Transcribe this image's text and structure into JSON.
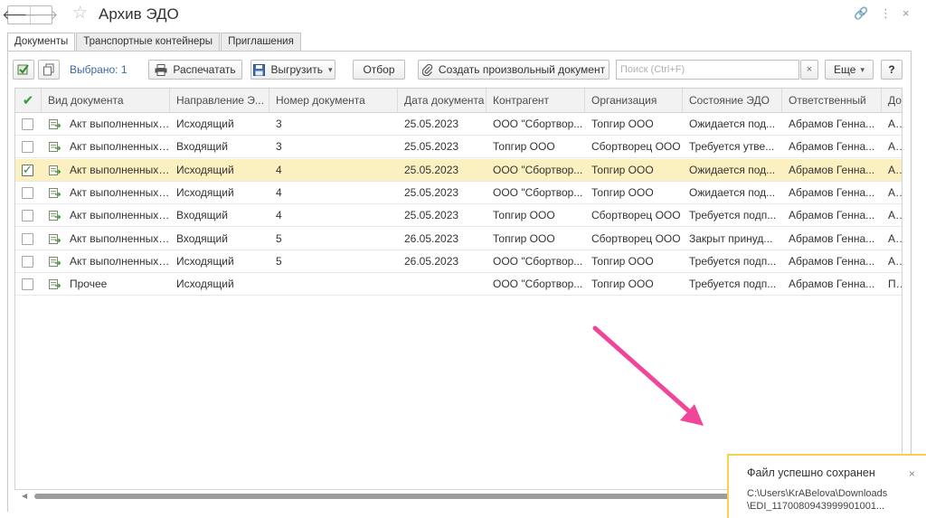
{
  "window": {
    "title": "Архив ЭДО",
    "back_glyph": "🡐",
    "forward_glyph": "🡒",
    "star_glyph": "☆",
    "link_glyph": "🔗",
    "more_glyph": "⋮",
    "close_glyph": "×"
  },
  "tabs": [
    {
      "label": "Документы",
      "active": true
    },
    {
      "label": "Транспортные контейнеры",
      "active": false
    },
    {
      "label": "Приглашения",
      "active": false
    }
  ],
  "toolbar": {
    "selected_label": "Выбрано: 1",
    "print_label": "Распечатать",
    "export_label": "Выгрузить",
    "filter_label": "Отбор",
    "create_label": "Создать произвольный документ",
    "search_placeholder": "Поиск (Ctrl+F)",
    "clear_glyph": "×",
    "more_label": "Еще",
    "help_label": "?",
    "dropdown_glyph": "▾"
  },
  "columns": [
    "Вид документа",
    "Направление Э...",
    "Номер документа",
    "Дата документа",
    "Контрагент",
    "Организация",
    "Состояние ЭДО",
    "Ответственный",
    "Док"
  ],
  "rows": [
    {
      "checked": false,
      "type": "Акт выполненных ...",
      "direction": "Исходящий",
      "number": "3",
      "date": "25.05.2023",
      "counterparty": "ООО \"Сбортвор...",
      "org": "Топгир ООО",
      "state": "Ожидается под...",
      "responsible": "Абрамов Генна...",
      "doc": "Акт"
    },
    {
      "checked": false,
      "type": "Акт выполненных ...",
      "direction": "Входящий",
      "number": "3",
      "date": "25.05.2023",
      "counterparty": "Топгир ООО",
      "org": "Сбортворец ООО",
      "state": "Требуется утве...",
      "responsible": "Абрамов Генна...",
      "doc": "Акт"
    },
    {
      "checked": true,
      "type": "Акт выполненных ...",
      "direction": "Исходящий",
      "number": "4",
      "date": "25.05.2023",
      "counterparty": "ООО \"Сбортвор...",
      "org": "Топгир ООО",
      "state": "Ожидается под...",
      "responsible": "Абрамов Генна...",
      "doc": "Акт"
    },
    {
      "checked": false,
      "type": "Акт выполненных ...",
      "direction": "Исходящий",
      "number": "4",
      "date": "25.05.2023",
      "counterparty": "ООО \"Сбортвор...",
      "org": "Топгир ООО",
      "state": "Ожидается под...",
      "responsible": "Абрамов Генна...",
      "doc": "Акт"
    },
    {
      "checked": false,
      "type": "Акт выполненных ...",
      "direction": "Входящий",
      "number": "4",
      "date": "25.05.2023",
      "counterparty": "Топгир ООО",
      "org": "Сбортворец ООО",
      "state": "Требуется подп...",
      "responsible": "Абрамов Генна...",
      "doc": "Акт"
    },
    {
      "checked": false,
      "type": "Акт выполненных ...",
      "direction": "Входящий",
      "number": "5",
      "date": "26.05.2023",
      "counterparty": "Топгир ООО",
      "org": "Сбортворец ООО",
      "state": "Закрыт принуд...",
      "responsible": "Абрамов Генна...",
      "doc": "Акт"
    },
    {
      "checked": false,
      "type": "Акт выполненных ...",
      "direction": "Исходящий",
      "number": "5",
      "date": "26.05.2023",
      "counterparty": "ООО \"Сбортвор...",
      "org": "Топгир ООО",
      "state": "Требуется подп...",
      "responsible": "Абрамов Генна...",
      "doc": "Акт"
    },
    {
      "checked": false,
      "type": "Прочее",
      "direction": "Исходящий",
      "number": "",
      "date": "",
      "counterparty": "ООО \"Сбортвор...",
      "org": "Топгир ООО",
      "state": "Требуется подп...",
      "responsible": "Абрамов Генна...",
      "doc": "Про"
    }
  ],
  "notification": {
    "title": "Файл успешно сохранен",
    "line1": "C:\\Users\\KrABelova\\Downloads",
    "line2": "\\EDI_1170080943999901001...",
    "close_glyph": "×"
  },
  "colors": {
    "selected_row": "#fbf0c0",
    "arrow": "#f0469a",
    "notification_border": "#f5d24a",
    "check_green": "#2e9e3a"
  }
}
